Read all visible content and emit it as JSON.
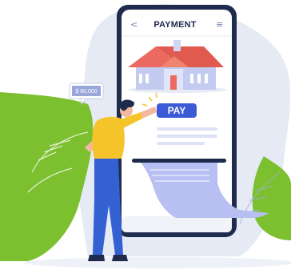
{
  "phone": {
    "header_title": "PAYMENT",
    "back_icon": "<",
    "menu_icon": "≡",
    "pay_button_label": "PAY"
  },
  "price_bubble": {
    "text": "$ 60,000"
  },
  "colors": {
    "phone_frame": "#1f2b4d",
    "pay_button": "#3d5ad6",
    "blob_green": "#7cc02f",
    "blob_blue": "#e3e9f5",
    "receipt": "#b8bff3",
    "house_roof": "#ea6a5f",
    "house_wall": "#bac3ef",
    "shirt": "#f5c42b",
    "pants": "#3361d2"
  },
  "icons": [
    "back-icon",
    "menu-icon",
    "house-illustration",
    "person-illustration",
    "receipt-illustration"
  ]
}
